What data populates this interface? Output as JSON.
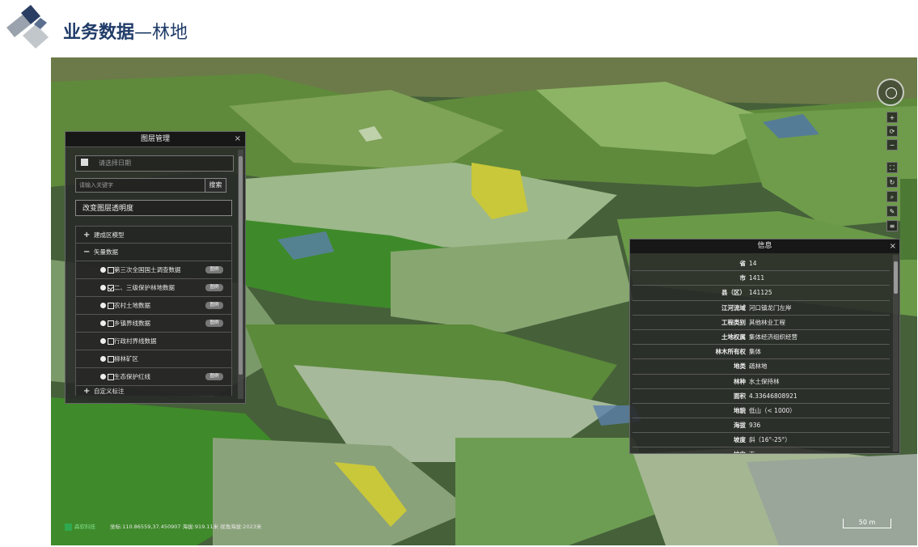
{
  "header": {
    "title_bold": "业务数据",
    "title_sub": "—林地"
  },
  "layer_panel": {
    "title": "图层管理",
    "close": "×",
    "date_placeholder": "请选择日期",
    "search_placeholder": "请输入关键字",
    "search_button": "搜索",
    "opacity_button": "改变图层透明度",
    "tree": [
      {
        "expander": "+",
        "label": "建成区模型"
      },
      {
        "expander": "−",
        "label": "矢量数据"
      },
      {
        "label": "第三次全国国土调查数据",
        "checked": false,
        "legend": true
      },
      {
        "label": "二、三级保护林地数据",
        "checked": true,
        "legend": true
      },
      {
        "label": "农村土地数据",
        "checked": false,
        "legend": true
      },
      {
        "label": "乡镇界线数据",
        "checked": false,
        "legend": true
      },
      {
        "label": "行政村界线数据",
        "checked": false,
        "legend": false
      },
      {
        "label": "柳林矿区",
        "checked": false,
        "legend": false
      },
      {
        "label": "生态保护红线",
        "checked": false,
        "legend": true
      },
      {
        "expander": "+",
        "label": "自定义标注"
      }
    ],
    "legend_label": "图例"
  },
  "info_panel": {
    "title": "信息",
    "close": "×",
    "rows": [
      {
        "key": "省",
        "value": "14"
      },
      {
        "key": "市",
        "value": "1411"
      },
      {
        "key": "县（区）",
        "value": "141125"
      },
      {
        "key": "江河流域",
        "value": "河口镇龙门左岸"
      },
      {
        "key": "工程类别",
        "value": "其他林业工程"
      },
      {
        "key": "土地权属",
        "value": "集体经济组织经营"
      },
      {
        "key": "林木所有权",
        "value": "集体"
      },
      {
        "key": "地类",
        "value": "疏林地"
      },
      {
        "key": "林种",
        "value": "水土保持林"
      },
      {
        "key": "面积",
        "value": "4.33646808921"
      },
      {
        "key": "地貌",
        "value": "低山（< 1000）"
      },
      {
        "key": "海拔",
        "value": "936"
      },
      {
        "key": "坡度",
        "value": "斜（16°-25°）"
      },
      {
        "key": "坡向",
        "value": "南"
      }
    ]
  },
  "toolbar": {
    "zoom_in": "+",
    "reset": "⟳",
    "zoom_out": "−",
    "fullscreen": "⛶",
    "rotate": "↻",
    "search": "⌕",
    "tools": "✎",
    "menu": "≡"
  },
  "status": {
    "brand": "森软科技",
    "coords": "坐标:110.86559,37.450907 海拔:919.11米 视角海拔:2023米"
  },
  "scale": "50 m",
  "colors": {
    "header_title": "#1f3b68",
    "panel_bg": "#282828",
    "forest_green": "#3f8a2a",
    "highlight_yellow": "#c9c83a"
  }
}
